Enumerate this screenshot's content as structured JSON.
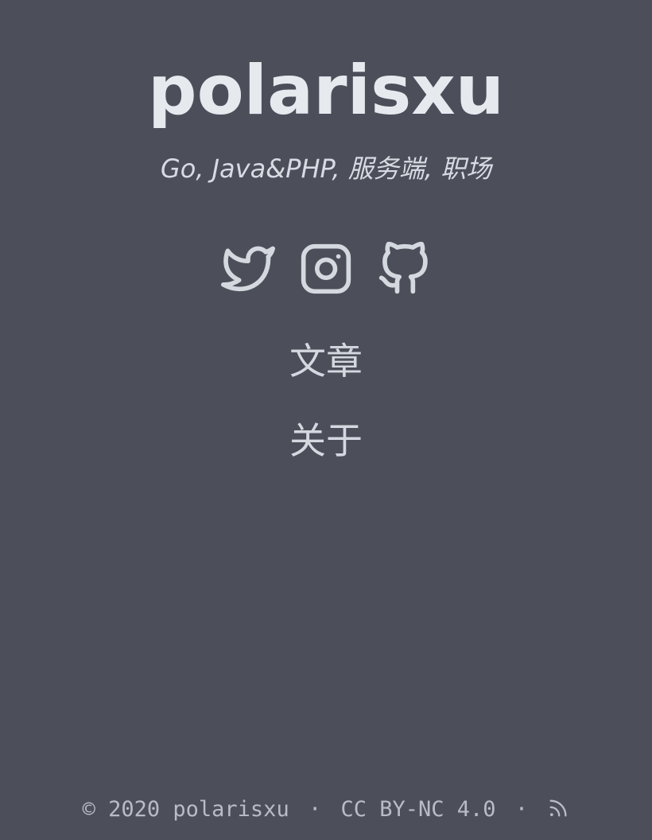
{
  "site": {
    "title": "polarisxu",
    "description": "Go, Java&PHP, 服务端, 职场"
  },
  "social": [
    {
      "name": "twitter",
      "icon": "twitter-icon"
    },
    {
      "name": "instagram",
      "icon": "instagram-icon"
    },
    {
      "name": "github",
      "icon": "github-icon"
    }
  ],
  "nav": {
    "items": [
      {
        "label": "文章"
      },
      {
        "label": "关于"
      }
    ]
  },
  "footer": {
    "copyright": "© 2020 polarisxu",
    "separator": "·",
    "license": "CC BY-NC 4.0",
    "rss_icon": "rss-icon"
  },
  "colors": {
    "background": "#4c4f5a",
    "title": "#e6eaef",
    "text": "#d4d8df",
    "footer": "#b8bcc5"
  }
}
